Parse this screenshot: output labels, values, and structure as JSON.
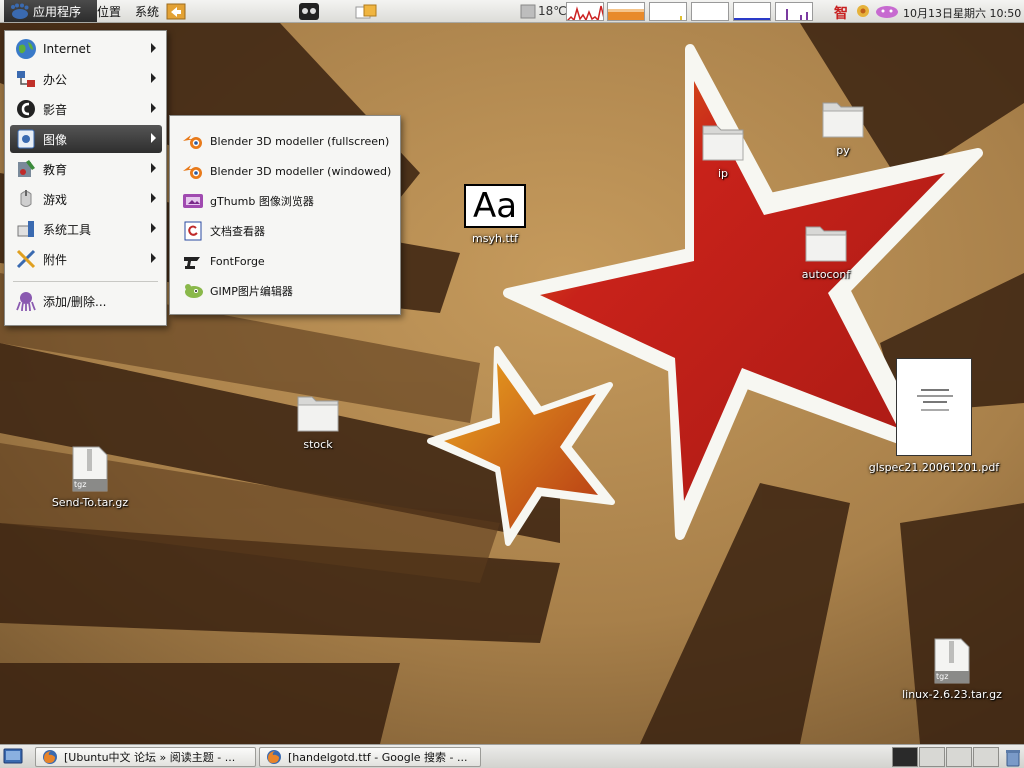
{
  "top_panel": {
    "menus": [
      {
        "label": "应用程序",
        "active": true
      },
      {
        "label": "位置",
        "active": false
      },
      {
        "label": "系统",
        "active": false
      }
    ],
    "weather_temp": "18℃",
    "clock": "10月13日星期六 10:50",
    "tray_char": "智"
  },
  "app_menu": {
    "items": [
      {
        "label": "Internet",
        "icon": "globe-icon",
        "submenu": true
      },
      {
        "label": "办公",
        "icon": "office-icon",
        "submenu": true
      },
      {
        "label": "影音",
        "icon": "sound-video-icon",
        "submenu": true
      },
      {
        "label": "图像",
        "icon": "graphics-icon",
        "submenu": true,
        "active": true
      },
      {
        "label": "教育",
        "icon": "education-icon",
        "submenu": true
      },
      {
        "label": "游戏",
        "icon": "games-icon",
        "submenu": true
      },
      {
        "label": "系统工具",
        "icon": "system-tools-icon",
        "submenu": true
      },
      {
        "label": "附件",
        "icon": "accessories-icon",
        "submenu": true
      }
    ],
    "add_remove_label": "添加/删除..."
  },
  "graphics_submenu": {
    "items": [
      {
        "label": "Blender 3D modeller (fullscreen)",
        "icon": "blender-icon"
      },
      {
        "label": "Blender 3D modeller (windowed)",
        "icon": "blender-icon"
      },
      {
        "label": "gThumb 图像浏览器",
        "icon": "gthumb-icon"
      },
      {
        "label": "文档查看器",
        "icon": "document-viewer-icon"
      },
      {
        "label": "FontForge",
        "icon": "fontforge-icon"
      },
      {
        "label": "GIMP图片编辑器",
        "icon": "gimp-icon"
      }
    ]
  },
  "desktop_icons": {
    "font_file": {
      "label": "msyh.ttf",
      "preview": "Aa"
    },
    "folder_ip": {
      "label": "ip"
    },
    "folder_py": {
      "label": "py"
    },
    "folder_autoconf": {
      "label": "autoconf"
    },
    "folder_stock": {
      "label": "stock"
    },
    "archive_sendto": {
      "label": "Send-To.tar.gz",
      "badge": "tgz"
    },
    "pdf_file": {
      "label": "glspec21.20061201.pdf"
    },
    "archive_linux": {
      "label": "linux-2.6.23.tar.gz",
      "badge": "tgz"
    }
  },
  "taskbar": {
    "tasks": [
      {
        "label": "[Ubuntu中文 论坛 » 阅读主题 - ..."
      },
      {
        "label": "[handelgotd.ttf - Google 搜索 - ..."
      }
    ]
  },
  "colors": {
    "star_red": "#c8221a",
    "star_white": "#f7f7f2",
    "menu_active": "#3a3a3a"
  }
}
